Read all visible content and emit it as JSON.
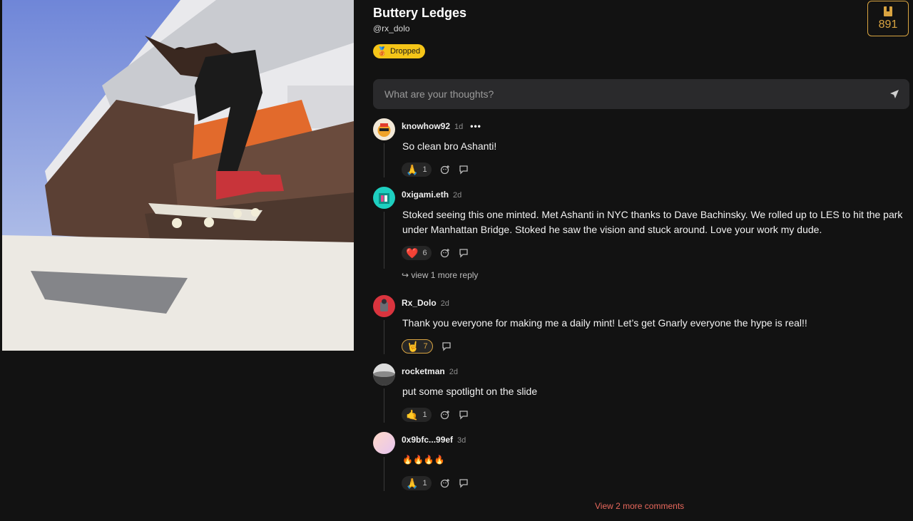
{
  "post": {
    "title": "Buttery Ledges",
    "author": "@rx_dolo",
    "status_badge": "Dropped",
    "mint_count": "891"
  },
  "composer": {
    "placeholder": "What are your thoughts?"
  },
  "comments": [
    {
      "user": "knowhow92",
      "time": "1d",
      "more": "•••",
      "text": "So clean bro Ashanti!",
      "reaction": "🙏",
      "reaction_count": "1"
    },
    {
      "user": "0xigami.eth",
      "time": "2d",
      "text": "Stoked seeing this one minted. Met Ashanti in NYC thanks to Dave Bachinsky. We rolled up to LES to hit the park under Manhattan Bridge. Stoked he saw the vision and stuck around. Love your work my dude.",
      "reaction": "❤️",
      "reaction_count": "6",
      "view_replies": "↪ view 1 more reply"
    },
    {
      "user": "Rx_Dolo",
      "time": "2d",
      "text": "Thank you everyone for making me a daily mint! Let’s get Gnarly everyone the hype is real!!",
      "reaction": "🤘",
      "reaction_count": "7"
    },
    {
      "user": "rocketman",
      "time": "2d",
      "text": "put some spotlight on the slide",
      "reaction": "🤙",
      "reaction_count": "1"
    },
    {
      "user": "0x9bfc...99ef",
      "time": "3d",
      "text": "🔥🔥🔥🔥",
      "reaction": "🙏",
      "reaction_count": "1"
    }
  ],
  "view_more_comments": "View 2 more comments",
  "colors": {
    "accent": "#d9a441",
    "badge": "#f5c518",
    "link": "#e8685c",
    "background": "#121212"
  }
}
